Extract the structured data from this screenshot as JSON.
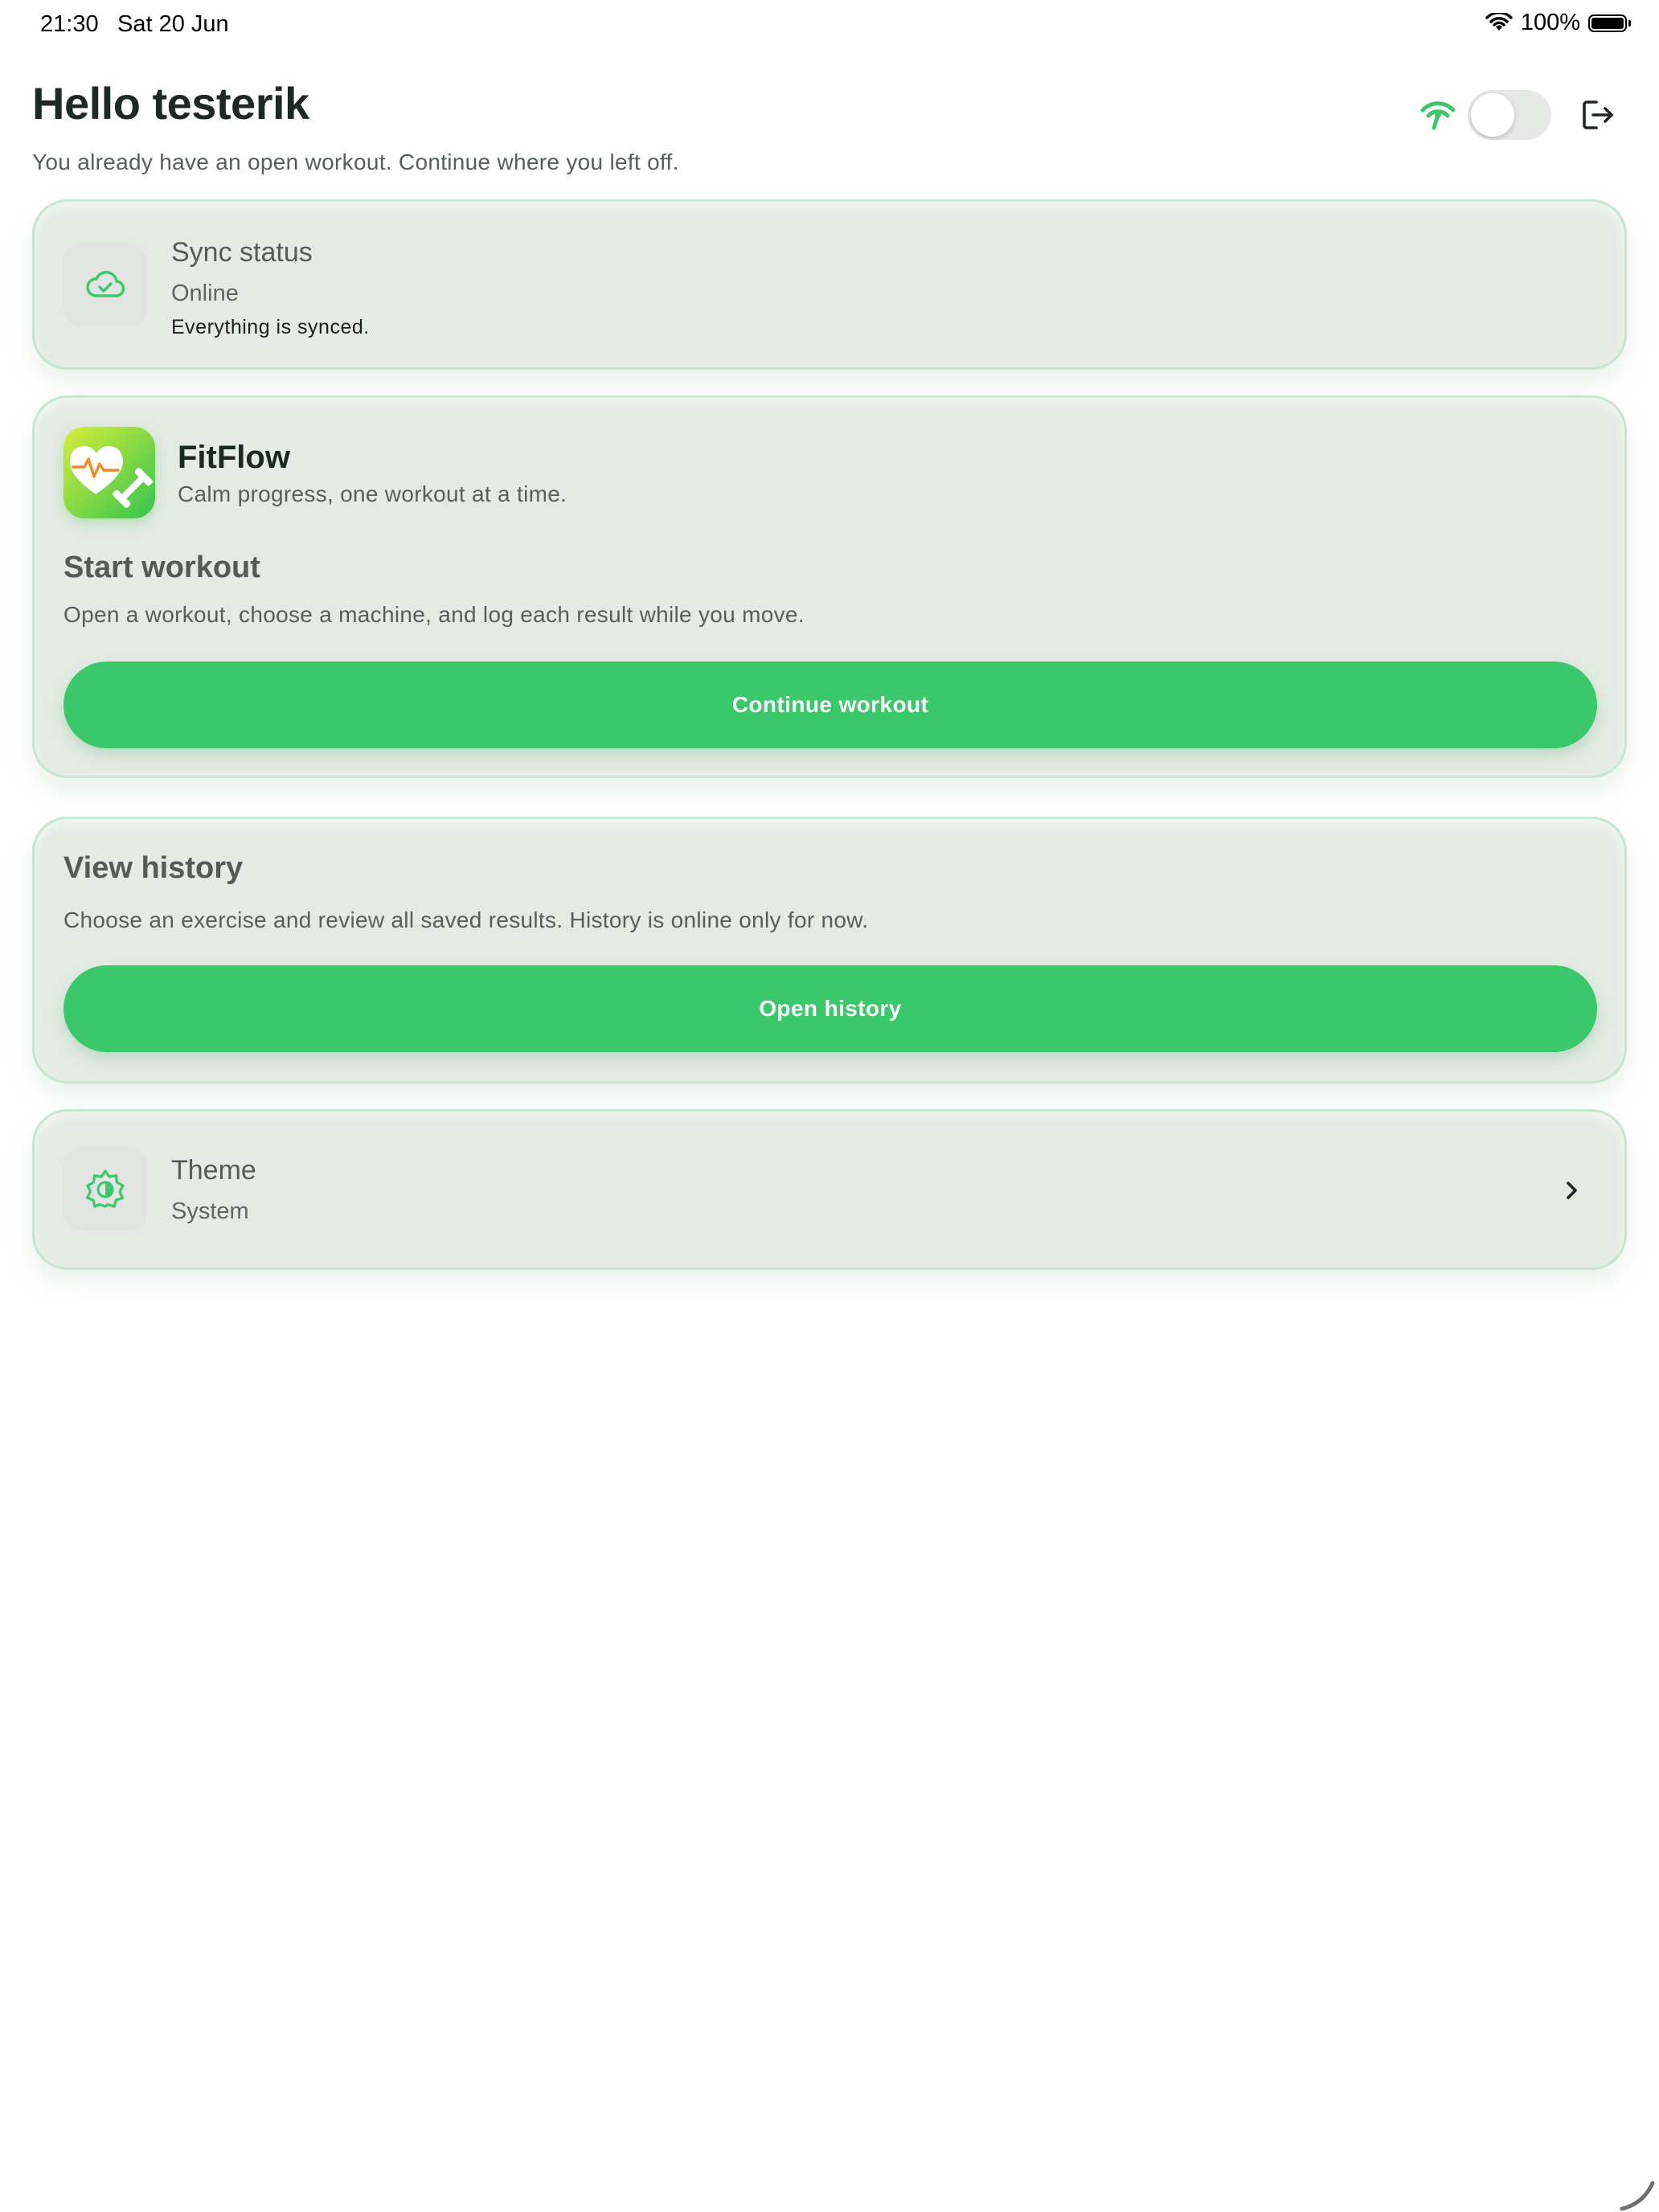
{
  "status_bar": {
    "time": "21:30",
    "date": "Sat 20 Jun",
    "battery": "100%"
  },
  "header": {
    "greeting": "Hello testerik",
    "subtitle": "You already have an open workout. Continue where you left off."
  },
  "sync": {
    "title": "Sync status",
    "status": "Online",
    "detail": "Everything is synced."
  },
  "app": {
    "name": "FitFlow",
    "tagline": "Calm progress, one workout at a time."
  },
  "workout": {
    "title": "Start workout",
    "description": "Open a workout, choose a machine, and log each result while you move.",
    "button_label": "Continue workout"
  },
  "history": {
    "title": "View history",
    "description": "Choose an exercise and review all saved results. History is online only for now.",
    "button_label": "Open history"
  },
  "theme": {
    "title": "Theme",
    "value": "System"
  },
  "colors": {
    "accent": "#3ac86b",
    "card_background": "#e3ebe3",
    "card_border": "#c5e7cd"
  }
}
